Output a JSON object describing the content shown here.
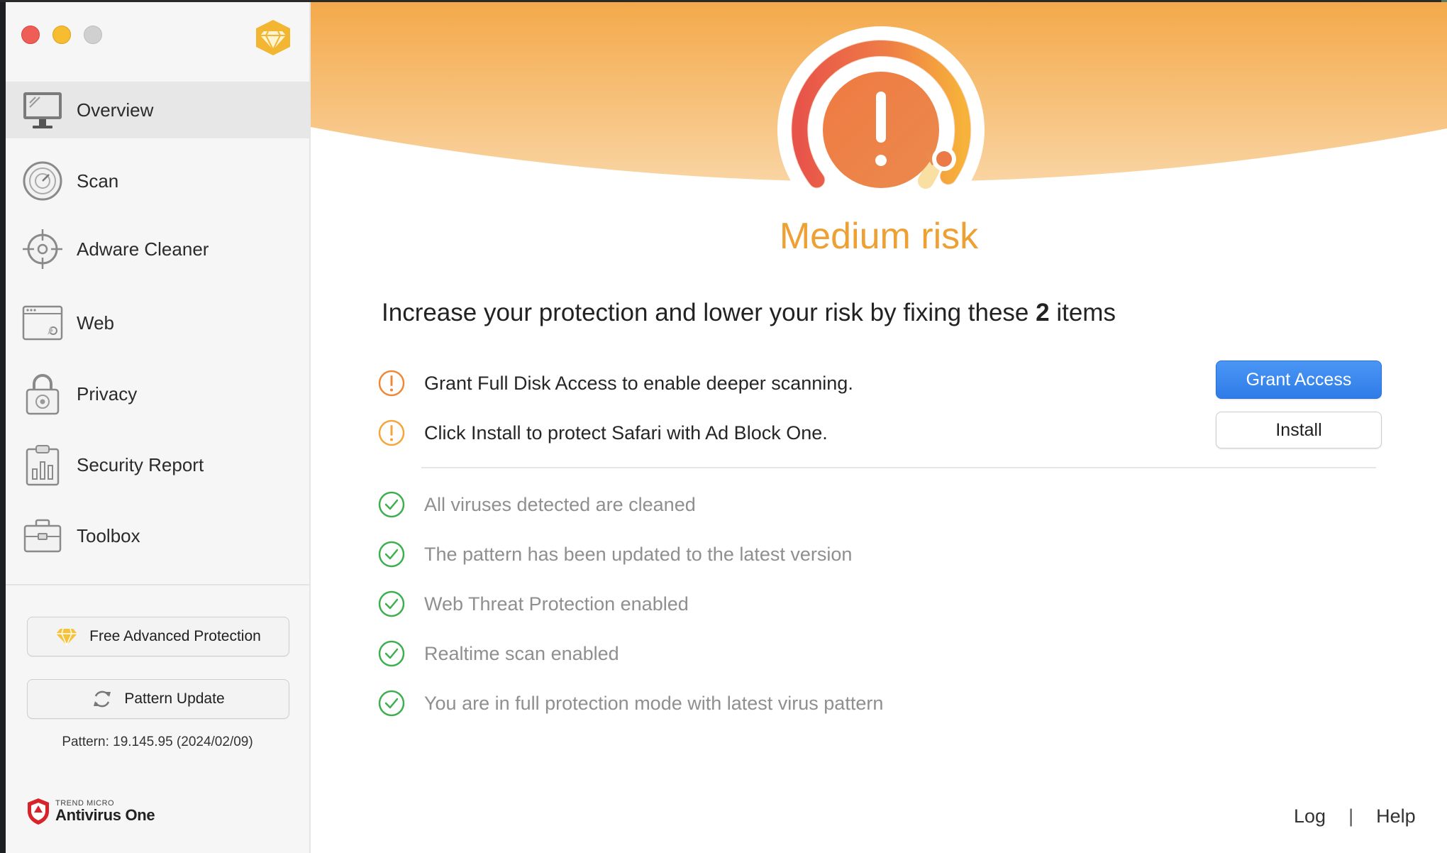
{
  "sidebar": {
    "items": [
      {
        "label": "Overview",
        "icon": "monitor-icon",
        "active": true
      },
      {
        "label": "Scan",
        "icon": "scan-icon"
      },
      {
        "label": "Adware Cleaner",
        "icon": "crosshair-icon"
      },
      {
        "label": "Web",
        "icon": "browser-window-icon"
      },
      {
        "label": "Privacy",
        "icon": "lock-icon"
      },
      {
        "label": "Security Report",
        "icon": "report-chart-icon"
      },
      {
        "label": "Toolbox",
        "icon": "toolbox-icon"
      }
    ],
    "free_advanced_protection_label": "Free Advanced Protection",
    "pattern_update_label": "Pattern Update",
    "pattern_info": "Pattern: 19.145.95 (2024/02/09)",
    "brand_small": "TREND MICRO",
    "brand_name": "Antivirus One"
  },
  "main": {
    "risk_level": "Medium risk",
    "headline_before": "Increase your protection and lower your risk by fixing these ",
    "headline_count": "2",
    "headline_after": " items",
    "warnings": [
      {
        "text": "Grant Full Disk Access to enable deeper scanning.",
        "action": "Grant Access"
      },
      {
        "text": "Click Install to protect Safari with Ad Block One.",
        "action": "Install"
      }
    ],
    "ok_items": [
      "All viruses detected are cleaned",
      "The pattern has been updated to the latest version",
      "Web Threat Protection enabled",
      "Realtime scan enabled",
      "You are in full protection mode with latest virus pattern"
    ],
    "footer": {
      "log": "Log",
      "separator": "|",
      "help": "Help"
    }
  },
  "colors": {
    "accent_orange": "#eda033",
    "warning_icon": "#f0883a",
    "ok_icon": "#3fae4f",
    "primary_button": "#2f7ce8"
  }
}
